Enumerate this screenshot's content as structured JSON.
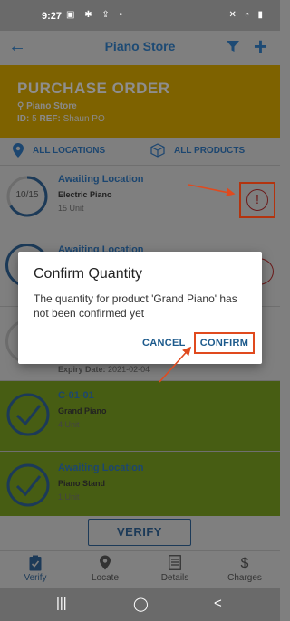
{
  "status_bar": {
    "time": "9:27",
    "left_icons": "▣ ✱ ⇪ •",
    "right_icons": "✕ ◔ ▮"
  },
  "app_bar": {
    "title": "Piano Store",
    "back_icon": "back-arrow-icon",
    "filter_icon": "filter-icon",
    "add_icon": "plus-icon"
  },
  "order": {
    "title": "PURCHASE ORDER",
    "store": "Piano Store",
    "id_label": "ID:",
    "id_value": "5",
    "ref_label": "REF:",
    "ref_value": "Shaun PO"
  },
  "filters": {
    "locations_label": "ALL LOCATIONS",
    "products_label": "ALL PRODUCTS"
  },
  "items": [
    {
      "status": "Awaiting Location",
      "name": "Electric Piano",
      "qty": "15 Unit",
      "count": "10/15",
      "progress": 0.6667
    },
    {
      "status": "Awaiting Location",
      "name": "",
      "qty": ""
    },
    {
      "status": "",
      "name": "",
      "qty": "",
      "expiry_label": "Expiry Date:",
      "expiry_value": "2021-02-04"
    },
    {
      "status": "C-01-01",
      "name": "Grand Piano",
      "qty": "4 Unit"
    },
    {
      "status": "Awaiting Location",
      "name": "Piano Stand",
      "qty": "1 Unit"
    }
  ],
  "verify_label": "VERIFY",
  "nav": [
    {
      "label": "Verify",
      "icon": "clipboard-check-icon",
      "active": true
    },
    {
      "label": "Locate",
      "icon": "location-pin-icon",
      "active": false
    },
    {
      "label": "Details",
      "icon": "document-icon",
      "active": false
    },
    {
      "label": "Charges",
      "icon": "dollar-icon",
      "active": false
    }
  ],
  "dialog": {
    "title": "Confirm Quantity",
    "message": "The quantity for product 'Grand Piano' has not been confirmed yet",
    "cancel_label": "CANCEL",
    "confirm_label": "CONFIRM"
  },
  "colors": {
    "accent": "#1c4670",
    "annotation": "#e04a1e",
    "header_bg": "#7e6200",
    "confirmed_bg": "#475d13"
  }
}
